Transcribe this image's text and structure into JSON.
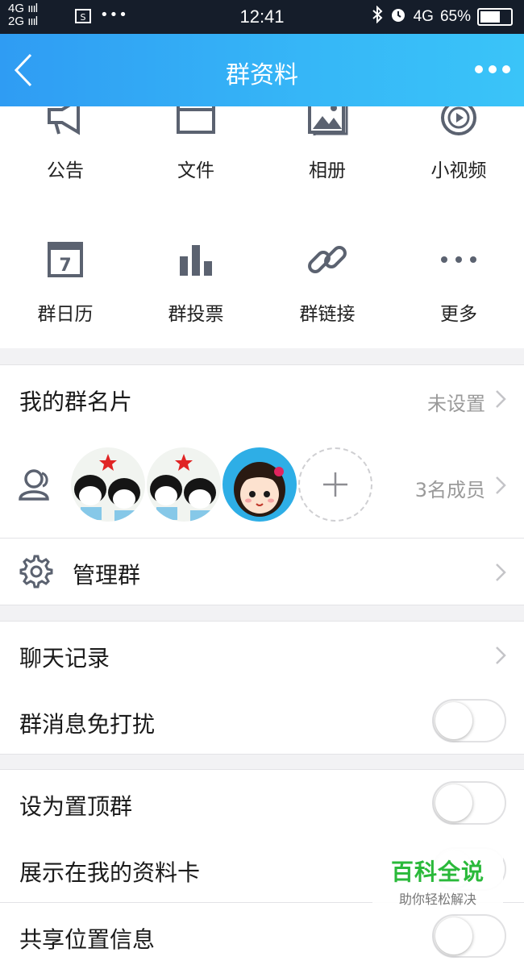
{
  "status_bar": {
    "network_top": "4G",
    "network_bottom": "2G",
    "sim_icon": "sim-card-icon",
    "more": "•••",
    "time": "12:41",
    "data_network": "4G",
    "battery": "65%"
  },
  "navbar": {
    "title": "群资料",
    "back_icon": "back-arrow-icon",
    "more_icon": "more-dots-icon"
  },
  "features": [
    {
      "label": "公告",
      "icon": "announcement-icon"
    },
    {
      "label": "文件",
      "icon": "file-icon"
    },
    {
      "label": "相册",
      "icon": "album-icon"
    },
    {
      "label": "小视频",
      "icon": "video-icon"
    },
    {
      "label": "群日历",
      "icon": "calendar-icon"
    },
    {
      "label": "群投票",
      "icon": "vote-icon"
    },
    {
      "label": "群链接",
      "icon": "link-icon"
    },
    {
      "label": "更多",
      "icon": "more-icon"
    }
  ],
  "calendar_day": "7",
  "group_card": {
    "label": "我的群名片",
    "value": "未设置"
  },
  "members": {
    "count_label": "3名成员"
  },
  "manage": {
    "label": "管理群"
  },
  "chat_history": {
    "label": "聊天记录"
  },
  "do_not_disturb": {
    "label": "群消息免打扰"
  },
  "pin_top": {
    "label": "设为置顶群"
  },
  "show_in_profile": {
    "label": "展示在我的资料卡"
  },
  "share_location": {
    "label": "共享位置信息"
  },
  "watermark": {
    "main": "百科全说",
    "sub": "助你轻松解决"
  },
  "colors": {
    "nav_start": "#2f9cf3",
    "nav_end": "#3ac4f8",
    "icon_gray": "#5b6270"
  }
}
